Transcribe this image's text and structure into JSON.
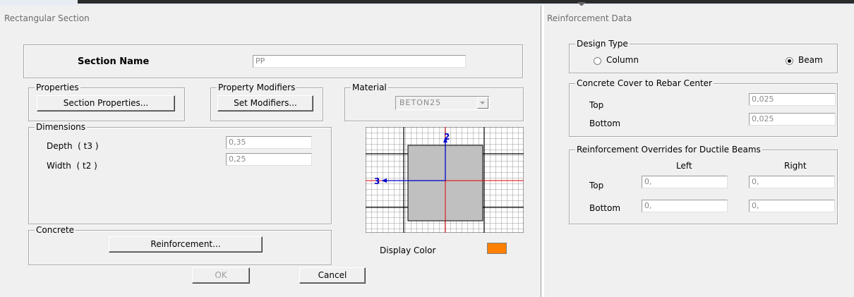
{
  "left_dialog": {
    "title": "Rectangular Section",
    "section_name_label": "Section Name",
    "section_name_value": "PP",
    "properties": {
      "legend": "Properties",
      "button": "Section Properties..."
    },
    "property_modifiers": {
      "legend": "Property Modifiers",
      "button": "Set Modifiers..."
    },
    "material": {
      "legend": "Material",
      "value": "BETON25"
    },
    "dimensions": {
      "legend": "Dimensions",
      "depth_label": "Depth  ( t3 )",
      "depth_value": "0,35",
      "width_label": "Width  ( t2 )",
      "width_value": "0,25"
    },
    "preview": {
      "axis_2": "2",
      "axis_3": "3"
    },
    "concrete": {
      "legend": "Concrete",
      "button": "Reinforcement..."
    },
    "display_color_label": "Display Color",
    "display_color": "#ff8000",
    "ok": "OK",
    "cancel": "Cancel"
  },
  "right_dialog": {
    "title": "Reinforcement Data",
    "design_type": {
      "legend": "Design Type",
      "column": "Column",
      "beam": "Beam",
      "selected": "Beam"
    },
    "cover": {
      "legend": "Concrete Cover to Rebar Center",
      "top_label": "Top",
      "top_value": "0,025",
      "bottom_label": "Bottom",
      "bottom_value": "0,025"
    },
    "overrides": {
      "legend": "Reinforcement Overrides for Ductile Beams",
      "left_header": "Left",
      "right_header": "Right",
      "top_label": "Top",
      "bottom_label": "Bottom",
      "top_left": "0,",
      "top_right": "0,",
      "bottom_left": "0,",
      "bottom_right": "0,"
    }
  }
}
